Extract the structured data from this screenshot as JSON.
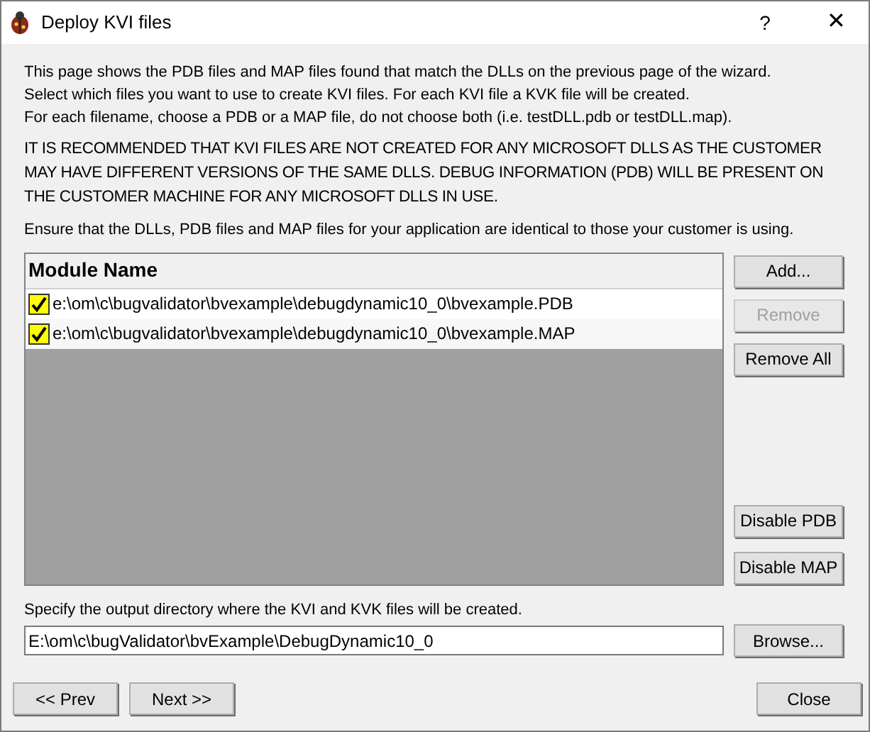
{
  "window": {
    "title": "Deploy KVI files",
    "help": "?",
    "close": "✕"
  },
  "intro": [
    "This page shows the PDB files and MAP files found that match the DLLs on the previous page of the wizard.",
    "Select which files you want to use to create KVI files. For each KVI file a KVK file will be created.",
    "For each filename, choose a PDB or a MAP file, do not choose both (i.e. testDLL.pdb or testDLL.map)."
  ],
  "warning": "IT IS RECOMMENDED THAT KVI FILES ARE NOT CREATED FOR ANY MICROSOFT DLLS AS THE CUSTOMER MAY HAVE DIFFERENT VERSIONS OF THE SAME DLLS. DEBUG INFORMATION (PDB) WILL BE PRESENT ON THE CUSTOMER MACHINE FOR ANY MICROSOFT DLLS IN USE.",
  "ensure": "Ensure that the DLLs, PDB files and MAP files for your application are identical to those your customer is using.",
  "list": {
    "column": "Module Name",
    "rows": [
      {
        "path": "e:\\om\\c\\bugvalidator\\bvexample\\debugdynamic10_0\\bvexample.PDB",
        "checked": true
      },
      {
        "path": "e:\\om\\c\\bugvalidator\\bvexample\\debugdynamic10_0\\bvexample.MAP",
        "checked": true
      }
    ]
  },
  "list_buttons": [
    {
      "label": "Add...",
      "disabled": false
    },
    {
      "label": "Remove",
      "disabled": true
    },
    {
      "label": "Remove All",
      "disabled": false
    }
  ],
  "disable_buttons": [
    {
      "label": "Disable PDB"
    },
    {
      "label": "Disable MAP"
    }
  ],
  "output": {
    "label": "Specify the output directory where the KVI and KVK files will be created.",
    "value": "E:\\om\\c\\bugValidator\\bvExample\\DebugDynamic10_0",
    "browse": "Browse..."
  },
  "nav": {
    "prev": "<< Prev",
    "next": "Next >>",
    "close": "Close"
  }
}
